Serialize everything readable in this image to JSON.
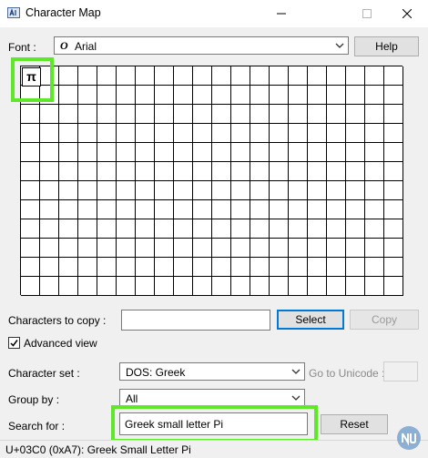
{
  "window": {
    "title": "Character Map"
  },
  "font": {
    "label": "Font :",
    "value": "Arial",
    "font_icon_glyph": "O"
  },
  "help_button": "Help",
  "selected_char": "π",
  "copy": {
    "label": "Characters to copy :",
    "value": "",
    "select_label": "Select",
    "copy_label": "Copy"
  },
  "advanced_view": {
    "label": "Advanced view",
    "checked": true
  },
  "charset": {
    "label": "Character set :",
    "value": "DOS: Greek"
  },
  "goto_unicode": {
    "label": "Go to Unicode :",
    "value": ""
  },
  "group_by": {
    "label": "Group by :",
    "value": "All"
  },
  "search": {
    "label": "Search for :",
    "value": "Greek small letter Pi",
    "reset_label": "Reset"
  },
  "status": {
    "text": "U+03C0 (0xA7): Greek Small Letter Pi"
  },
  "colors": {
    "highlight": "#5ee829",
    "accent": "#0078d7"
  },
  "icons": [
    "app-icon",
    "minimize-icon",
    "maximize-icon",
    "close-icon",
    "chevron-down-icon",
    "checkmark-icon",
    "watermark-logo-icon"
  ]
}
